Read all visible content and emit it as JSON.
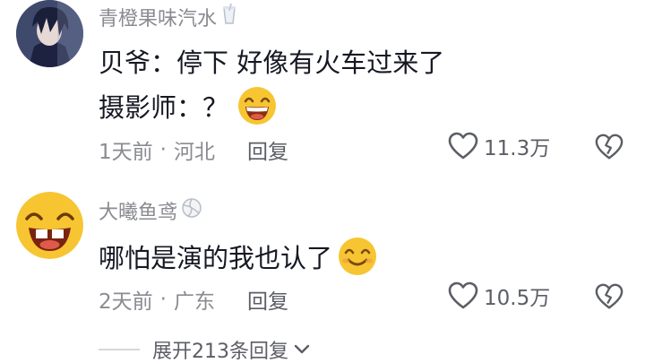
{
  "comments": [
    {
      "username": "青橙果味汽水",
      "username_badge": "cup-icon",
      "lines": [
        "贝爷：停下 好像有火车过来了",
        "摄影师：？"
      ],
      "emoji": "grin-emoji",
      "time": "1天前",
      "location": "河北",
      "reply_label": "回复",
      "likes": "11.3万"
    },
    {
      "username": "大曦鱼鸢",
      "username_badge": "volleyball-icon",
      "lines": [
        "哪怕是演的我也认了"
      ],
      "emoji": "smile-emoji",
      "time": "2天前",
      "location": "广东",
      "reply_label": "回复",
      "likes": "10.5万"
    }
  ],
  "expand_replies": "展开213条回复",
  "separator": "·",
  "colors": {
    "meta": "#8a8b91",
    "text": "#161823",
    "emoji_yellow": "#f7c531"
  }
}
